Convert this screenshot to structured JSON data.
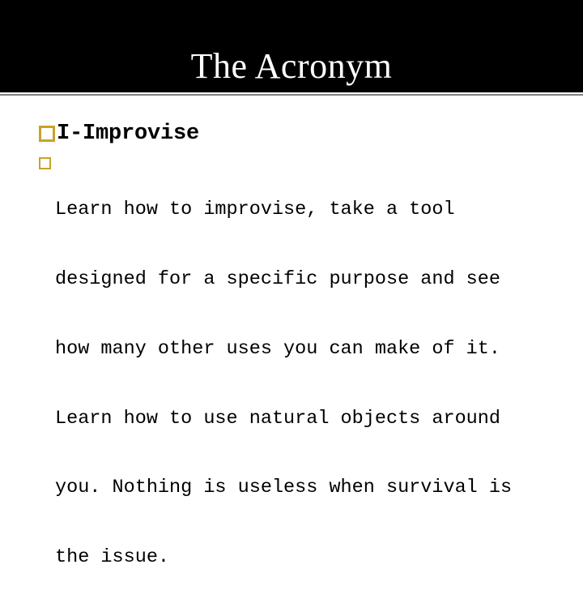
{
  "slide": {
    "title": "The Acronym",
    "title_band_color": "#000000",
    "title_text_color": "#ffffff",
    "rule_color": "#808080",
    "background_color": "#ffffff",
    "bullet_marker_color": "#C9A227",
    "body_text_color": "#000000"
  },
  "bullets": [
    {
      "level": 1,
      "marker": "hollow-square-bullet",
      "text": "I-Improvise"
    },
    {
      "level": 2,
      "marker": "hollow-square-bullet",
      "lines": [
        "Learn how to improvise, take a tool",
        "designed for a specific purpose and see",
        "how many other uses you can make of it.",
        "Learn how to use natural objects around",
        "you. Nothing is useless when survival is",
        "the issue."
      ],
      "line_1": "Learn how to improvise, take a tool",
      "line_2": "designed for a specific purpose and see",
      "line_3": "how many other uses you can make of it.",
      "line_4": "Learn how to use natural objects around",
      "line_5": "you. Nothing is useless when survival is",
      "line_6": "the issue."
    }
  ]
}
